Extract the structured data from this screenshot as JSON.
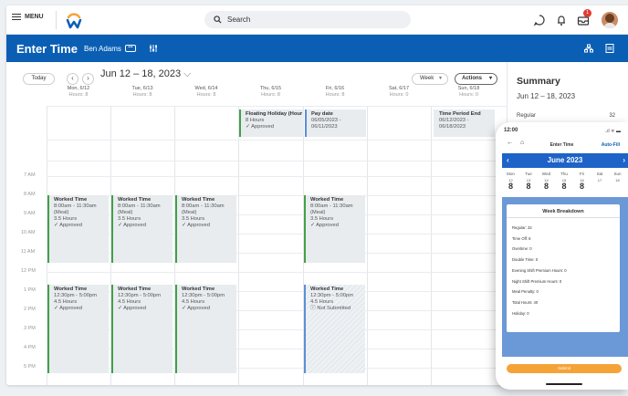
{
  "topbar": {
    "menu_label": "MENU",
    "search_placeholder": "Search",
    "notification_count": "1",
    "colors": {
      "logo_orange": "#f5a337",
      "logo_blue": "#0a5fb4",
      "badge": "#e03b30"
    }
  },
  "header": {
    "title": "Enter Time",
    "user": "Ben Adams",
    "tag": "•••",
    "bg": "#0a5fb4"
  },
  "toolbar": {
    "today": "Today",
    "range": "Jun 12 – 18, 2023",
    "view": "Week",
    "actions": "Actions"
  },
  "days": [
    {
      "label": "Mon, 6/12",
      "hours": "Hours: 8"
    },
    {
      "label": "Tue, 6/13",
      "hours": "Hours: 8"
    },
    {
      "label": "Wed, 6/14",
      "hours": "Hours: 8"
    },
    {
      "label": "Thu, 6/15",
      "hours": "Hours: 8"
    },
    {
      "label": "Fri, 6/16",
      "hours": "Hours: 8"
    },
    {
      "label": "Sat, 6/17",
      "hours": "Hours: 0"
    },
    {
      "label": "Sun, 6/18",
      "hours": "Hours: 0"
    }
  ],
  "time_labels": [
    "7 AM",
    "8 AM",
    "9 AM",
    "10 AM",
    "11 AM",
    "12 PM",
    "1 PM",
    "2 PM",
    "3 PM",
    "4 PM",
    "5 PM"
  ],
  "allday": {
    "holiday": {
      "title": "Floating Holiday (Hour",
      "hours": "8 Hours",
      "status": "✓ Approved"
    },
    "payday": {
      "title": "Pay date",
      "line1": "06/05/2023 -",
      "line2": "06/11/2023"
    },
    "period_end": {
      "title": "Time Period End",
      "line1": "06/12/2023 -",
      "line2": "06/18/2023"
    }
  },
  "morning_block": {
    "title": "Worked Time",
    "time": "8:00am - 11:30am",
    "meal": "(Meal)",
    "hours": "3.5 Hours",
    "status": "✓ Approved"
  },
  "afternoon_block": {
    "title": "Worked Time",
    "time": "12:30pm - 5:00pm",
    "hours": "4.5 Hours",
    "status": "✓ Approved",
    "status_fri": "ⓘ Not Submitted"
  },
  "summary": {
    "title": "Summary",
    "range": "Jun 12 – 18, 2023",
    "regular_label": "Regular",
    "regular_value": "32"
  },
  "phone": {
    "time": "12:00",
    "status": "..ıl ᯤ ▬",
    "title": "Enter Time",
    "autofill": "Auto-Fill",
    "month": "June 2023",
    "weekdays": [
      "Mon",
      "Tue",
      "Wed",
      "Thu",
      "Fri",
      "Sat",
      "Sun"
    ],
    "dates": [
      "12",
      "13",
      "14",
      "15",
      "16",
      "17",
      "18"
    ],
    "hours": [
      "8",
      "8",
      "8",
      "8",
      "8",
      "",
      ""
    ],
    "breakdown_title": "Week Breakdown",
    "breakdown": [
      "Regular: 32",
      "Time Off: 8",
      "Overtime: 0",
      "Double Time: 0",
      "Evening Shift Premium Hours: 0",
      "Night Shift Premium Hours: 0",
      "Meal Penalty: 0",
      "Total Hours: 40",
      "Holiday: 0"
    ],
    "submit": "Submit"
  }
}
